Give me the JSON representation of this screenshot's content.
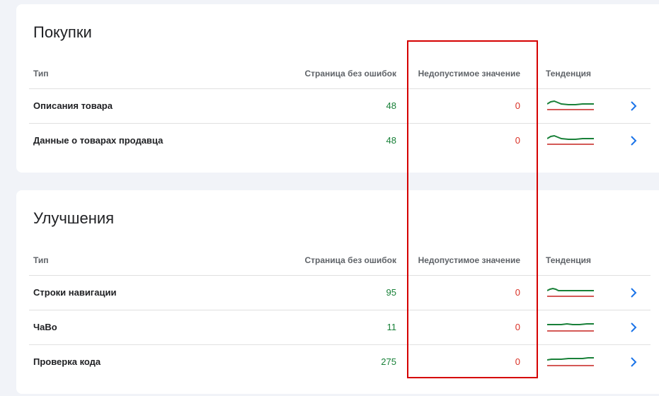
{
  "colors": {
    "valid": "#188038",
    "invalid": "#d93025",
    "trend_valid": "#188038",
    "trend_invalid": "#c5221f",
    "chevron": "#1a73e8",
    "highlight_box": "#d50000"
  },
  "sections": [
    {
      "title": "Покупки",
      "columns": {
        "type": "Тип",
        "valid": "Страница без ошибок",
        "invalid": "Недопустимое значение",
        "trend": "Тенденция"
      },
      "rows": [
        {
          "name": "Описания товара",
          "valid": "48",
          "invalid": "0",
          "icon": "chevron-right-icon"
        },
        {
          "name": "Данные о товарах продавца",
          "valid": "48",
          "invalid": "0",
          "icon": "chevron-right-icon"
        }
      ]
    },
    {
      "title": "Улучшения",
      "columns": {
        "type": "Тип",
        "valid": "Страница без ошибок",
        "invalid": "Недопустимое значение",
        "trend": "Тенденция"
      },
      "rows": [
        {
          "name": "Строки навигации",
          "valid": "95",
          "invalid": "0",
          "icon": "chevron-right-icon"
        },
        {
          "name": "ЧаВо",
          "valid": "11",
          "invalid": "0",
          "icon": "chevron-right-icon"
        },
        {
          "name": "Проверка кода",
          "valid": "275",
          "invalid": "0",
          "icon": "chevron-right-icon"
        }
      ]
    }
  ]
}
